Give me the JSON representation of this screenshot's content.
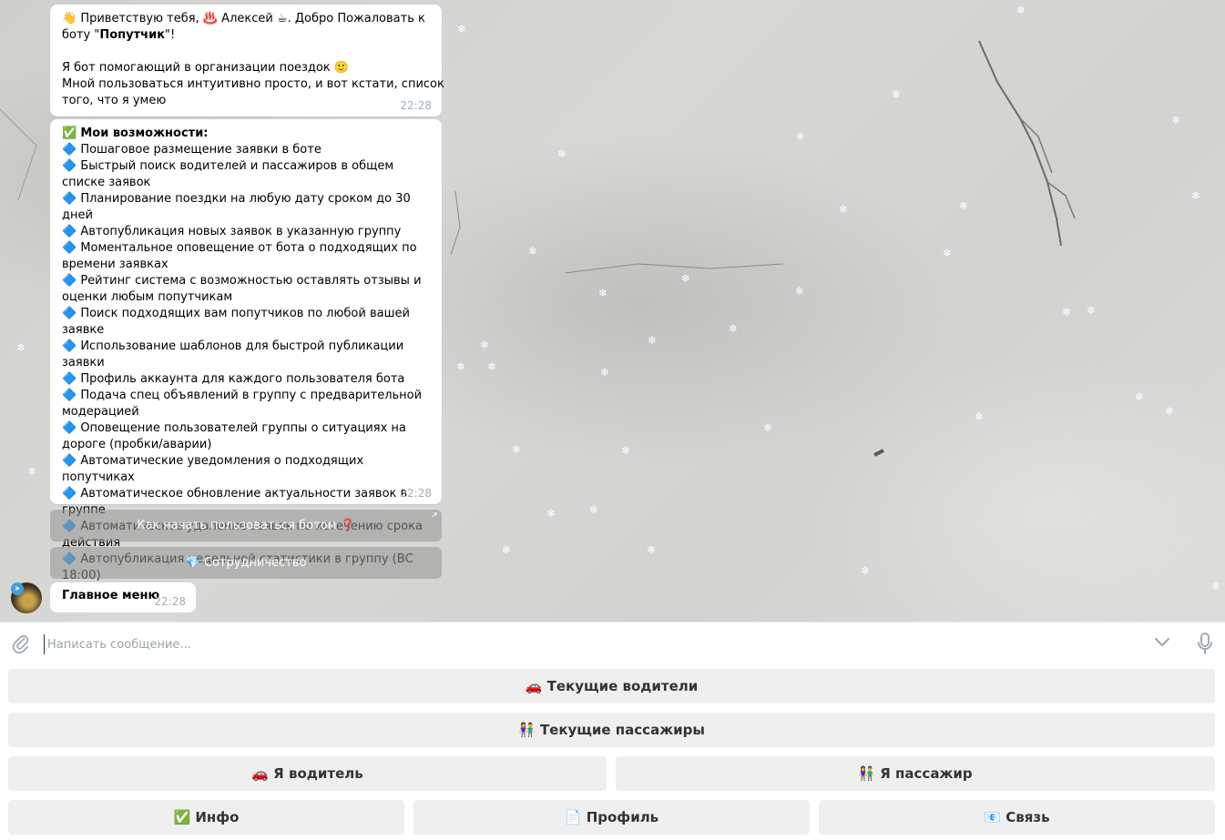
{
  "messages": {
    "welcome": {
      "line1": "👋 Приветствую тебя, ♨️ Алексей ☕. Добро Пожаловать к",
      "line2_prefix": "боту \"",
      "line2_bot": "Попутчик",
      "line2_suffix": "\"!",
      "line3": "Я бот помогающий в организации поездок 🙂",
      "line4": "Мной пользоваться интуитивно просто, и вот кстати, список",
      "line5": "того, что я умею",
      "time": "22:28"
    },
    "features": {
      "header_icon": "✅",
      "header": "Мои возможности:",
      "bullet": "🔷",
      "items": [
        "Пошаговое размещение заявки в боте",
        "Быстрый поиск водителей и пассажиров в общем списке заявок",
        "Планирование поездки на любую дату сроком до 30 дней",
        "Автопубликация новых заявок в указанную группу",
        "Моментальное оповещение от бота о подходящих по времени заявках",
        "Рейтинг система с возможностью оставлять отзывы и оценки любым попутчикам",
        "Поиск подходящих вам попутчиков по любой вашей заявке",
        "Использование шаблонов для быстрой публикации заявки",
        "Профиль аккаунта для каждого пользователя бота",
        "Подача спец объявлений в группу с предварительной модерацией",
        "Оповещение пользователей группы о ситуациях на дороге (пробки/аварии)",
        "Автоматические уведомления о подходящих попутчиках",
        "Автоматическое обновление актуальности заявок в группе",
        "Автоматическое удаление заявок по истечению срока действия",
        "Автопубликация недельной статистики в группу (ВС 18:00)"
      ],
      "time": "22:28"
    },
    "inline_buttons": {
      "how_to_start": "Как начать пользоваться ботом ❓",
      "how_to_start_arrow": "↗",
      "cooperation": "💎 Сотрудничество"
    },
    "main_menu": {
      "text": "Главное меню",
      "time": "22:28"
    }
  },
  "input": {
    "placeholder": "Написать сообщение..."
  },
  "keyboard": {
    "current_drivers": "🚗 Текущие водители",
    "current_passengers": "👫 Текущие пассажиры",
    "i_am_driver": "🚗 Я водитель",
    "i_am_passenger": "👫 Я пассажир",
    "info": "✅ Инфо",
    "profile": "📄 Профиль",
    "contact": "📧 Связь"
  },
  "colors": {
    "bubble_bg": "#ffffff",
    "time_text": "#a0acb6",
    "keyboard_button": "#efefef",
    "inline_button": "#969694"
  }
}
